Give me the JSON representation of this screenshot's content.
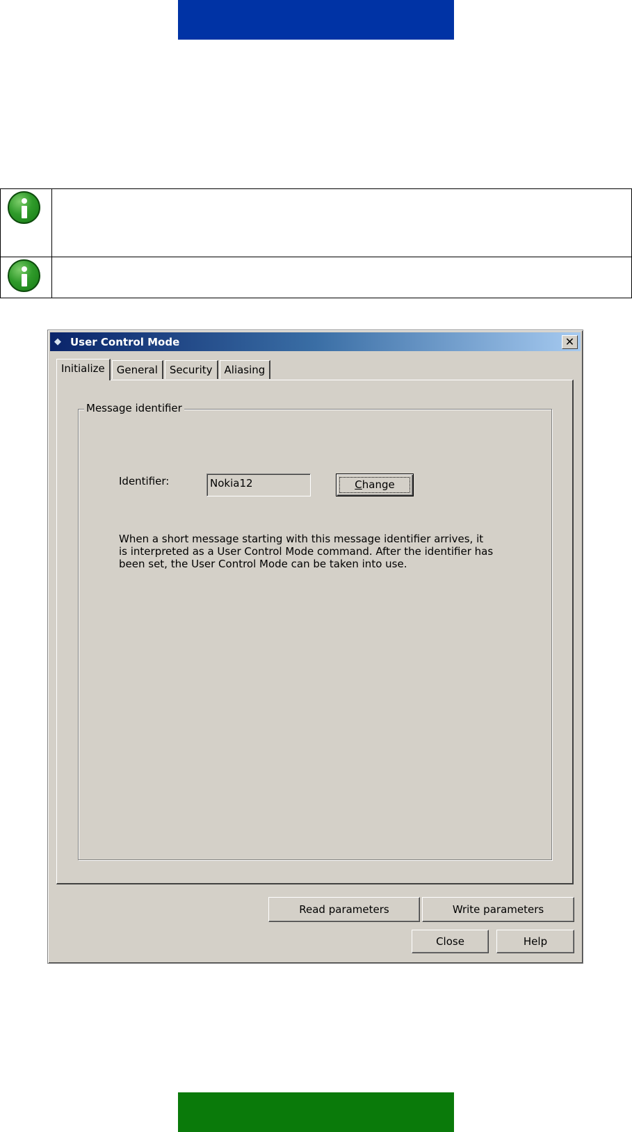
{
  "notes": [
    {
      "icon": "info-icon",
      "text": ""
    },
    {
      "icon": "info-icon",
      "text": ""
    }
  ],
  "dialog": {
    "title": "User Control Mode",
    "title_icon": "phone-icon",
    "close_symbol": "✕",
    "tabs": [
      {
        "label": "Initialize",
        "active": true
      },
      {
        "label": "General",
        "active": false
      },
      {
        "label": "Security",
        "active": false
      },
      {
        "label": "Aliasing",
        "active": false
      }
    ],
    "group": {
      "legend": "Message identifier",
      "identifier_label": "Identifier:",
      "identifier_value": "Nokia12",
      "change_button_mnemonic": "C",
      "change_button_rest": "hange",
      "description": "When a short message starting with this message identifier arrives, it is interpreted as a User Control Mode command. After the identifier has been set, the User Control Mode can be taken into use."
    },
    "buttons": {
      "read": "Read parameters",
      "write": "Write parameters",
      "close": "Close",
      "help": "Help"
    }
  },
  "colors": {
    "top_bar": "#0033a5",
    "bottom_bar": "#0a7a0a",
    "dialog_face": "#d4d0c8"
  }
}
